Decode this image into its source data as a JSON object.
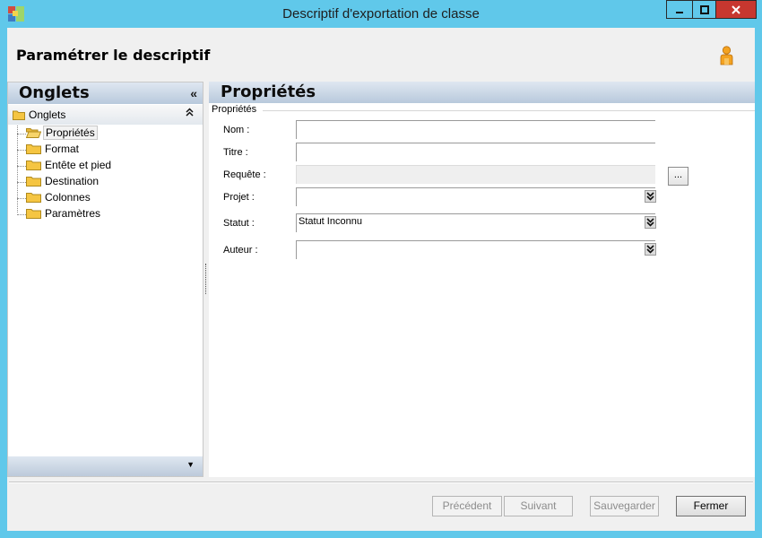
{
  "window": {
    "title": "Descriptif d'exportation de classe",
    "controls": {
      "minimize": "▬",
      "maximize": "□",
      "close": "✕"
    }
  },
  "header": {
    "title": "Paramétrer le descriptif",
    "icon": "user-icon"
  },
  "left_panel": {
    "title": "Onglets",
    "collapse_glyph": "«",
    "group": {
      "label": "Onglets",
      "toggle_glyph": "⌃"
    },
    "items": [
      {
        "label": "Propriétés",
        "selected": true
      },
      {
        "label": "Format",
        "selected": false
      },
      {
        "label": "Entête et pied",
        "selected": false
      },
      {
        "label": "Destination",
        "selected": false
      },
      {
        "label": "Colonnes",
        "selected": false
      },
      {
        "label": "Paramètres",
        "selected": false
      }
    ],
    "footer_glyph": "▼"
  },
  "right_panel": {
    "title": "Propriétés",
    "fieldset_legend": "Propriétés",
    "fields": {
      "nom": {
        "label": "Nom :",
        "value": ""
      },
      "titre": {
        "label": "Titre :",
        "value": ""
      },
      "requete": {
        "label": "Requête :",
        "value": "",
        "disabled": true
      },
      "projet": {
        "label": "Projet :",
        "value": ""
      },
      "statut": {
        "label": "Statut :",
        "value": "Statut Inconnu"
      },
      "auteur": {
        "label": "Auteur :",
        "value": ""
      }
    },
    "browse_button": "..."
  },
  "footer": {
    "buttons": {
      "precedent": {
        "label": "Précédent",
        "enabled": false
      },
      "suivant": {
        "label": "Suivant",
        "enabled": false
      },
      "sauvegarder": {
        "label": "Sauvegarder",
        "enabled": false
      },
      "fermer": {
        "label": "Fermer",
        "enabled": true
      }
    }
  },
  "colors": {
    "window_frame": "#60c8ea",
    "close_button": "#c7372f",
    "panel_header_gradient_top": "#dfe7f1",
    "panel_header_gradient_bottom": "#b8c9dc",
    "folder": "#f5c542"
  }
}
